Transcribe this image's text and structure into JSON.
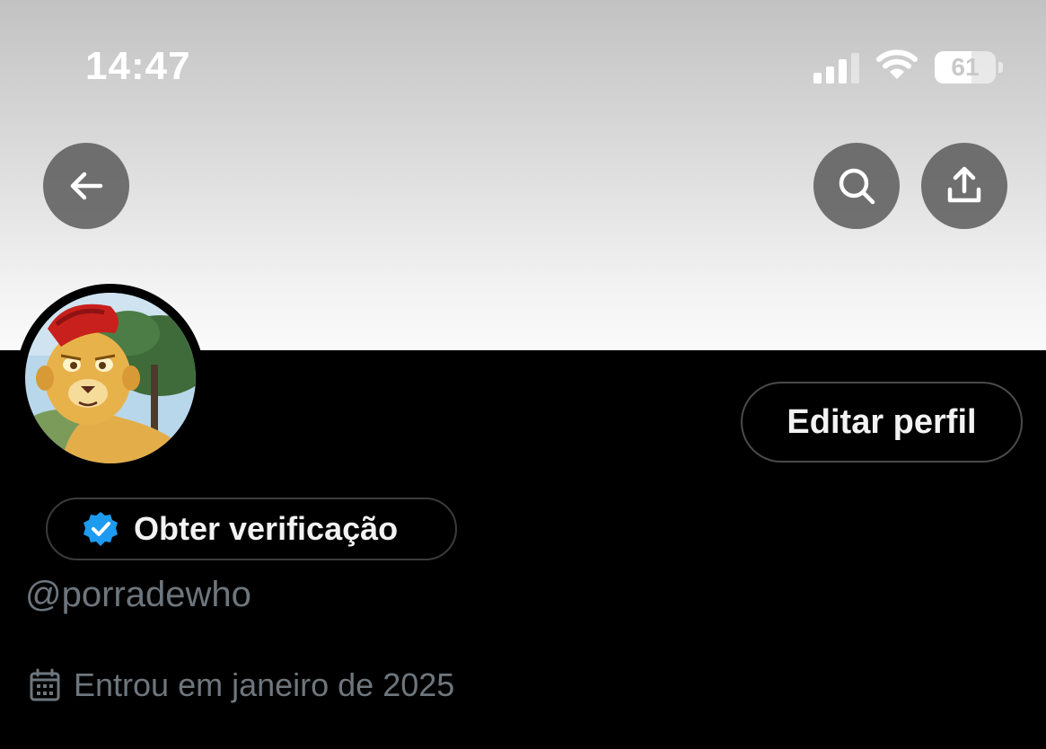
{
  "status_bar": {
    "time": "14:47",
    "battery": "61",
    "battery_level": 0.61
  },
  "header": {
    "back_icon": "arrow-left-icon",
    "search_icon": "search-icon",
    "share_icon": "share-icon"
  },
  "profile": {
    "edit_label": "Editar perfil",
    "verification_label": "Obter verificação",
    "handle": "@porradewho",
    "joined": "Entrou em janeiro de 2025"
  },
  "colors": {
    "background": "#000000",
    "muted_text": "#6e767d",
    "verified_blue": "#1d9bf0",
    "button_bg": "#5a5a5a"
  }
}
